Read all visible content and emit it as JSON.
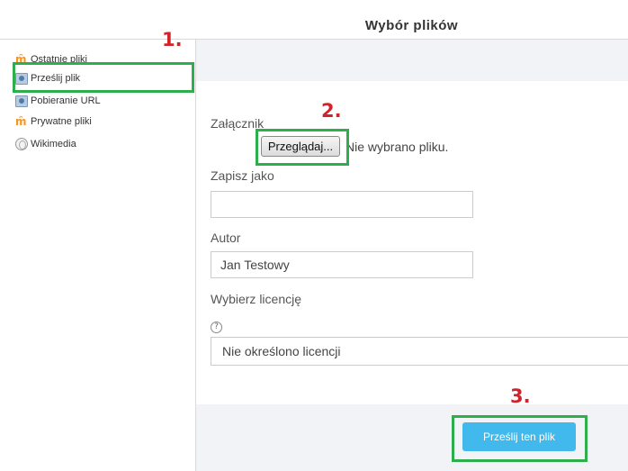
{
  "dialog": {
    "title": "Wybór plików"
  },
  "sidebar": {
    "items": [
      {
        "label": "Ostatnie pliki",
        "icon": "moodle-icon"
      },
      {
        "label": "Prześlij plik",
        "icon": "upload-icon"
      },
      {
        "label": "Pobieranie URL",
        "icon": "upload-icon"
      },
      {
        "label": "Prywatne pliki",
        "icon": "moodle-icon"
      },
      {
        "label": "Wikimedia",
        "icon": "globe-icon"
      }
    ]
  },
  "form": {
    "attachment_label": "Załącznik",
    "browse_label": "Przeglądaj...",
    "no_file_text": "Nie wybrano pliku.",
    "save_as_label": "Zapisz jako",
    "save_as_value": "",
    "author_label": "Autor",
    "author_value": "Jan Testowy",
    "license_label": "Wybierz licencję",
    "license_value": "Nie określono licencji",
    "submit_label": "Prześlij ten plik"
  },
  "annotations": {
    "step1": "1.",
    "step2": "2.",
    "step3": "3."
  },
  "colors": {
    "highlight": "#2fae4e",
    "step_number": "#d0242b",
    "primary_button": "#42b9ec"
  }
}
